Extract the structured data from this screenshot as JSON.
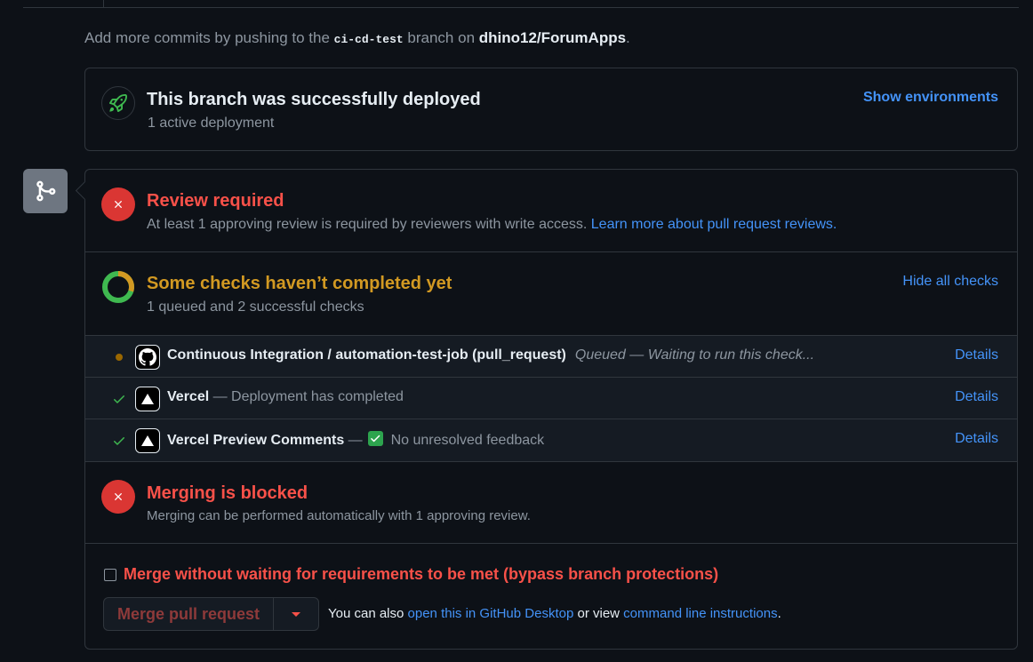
{
  "push_hint": {
    "prefix": "Add more commits by pushing to the",
    "branch": "ci-cd-test",
    "middle": "branch on",
    "repo": "dhino12/ForumApps",
    "suffix": "."
  },
  "deployment": {
    "title": "This branch was successfully deployed",
    "subtitle": "1 active deployment",
    "show_environments": "Show environments",
    "icon": "rocket-icon"
  },
  "review": {
    "title": "Review required",
    "subtitle": "At least 1 approving review is required by reviewers with write access.",
    "learn_more": "Learn more about pull request reviews."
  },
  "checks": {
    "title": "Some checks haven’t completed yet",
    "subtitle": "1 queued and 2 successful checks",
    "hide_all": "Hide all checks",
    "items": [
      {
        "status": "queued",
        "name": "Continuous Integration / automation-test-job (pull_request)",
        "description": "Queued — Waiting to run this check...",
        "details": "Details",
        "logo": "github-icon"
      },
      {
        "status": "success",
        "name": "Vercel",
        "description": "— Deployment has completed",
        "details": "Details",
        "logo": "vercel-icon"
      },
      {
        "status": "success",
        "name": "Vercel Preview Comments",
        "dash": "—",
        "description": "No unresolved feedback",
        "details": "Details",
        "logo": "vercel-icon"
      }
    ]
  },
  "merge_blocked": {
    "title": "Merging is blocked",
    "subtitle": "Merging can be performed automatically with 1 approving review."
  },
  "bypass": {
    "label": "Merge without waiting for requirements to be met (bypass branch protections)",
    "checked": false
  },
  "merge_button": {
    "label": "Merge pull request"
  },
  "alternatives": {
    "prefix": "You can also",
    "desktop_link": "open this in GitHub Desktop",
    "middle": "or view",
    "cli_link": "command line instructions",
    "suffix": "."
  },
  "colors": {
    "background": "#0d1117",
    "border": "#30363d",
    "danger": "#f85149",
    "warning": "#d29922",
    "success": "#3fb950",
    "link": "#4493f8"
  }
}
